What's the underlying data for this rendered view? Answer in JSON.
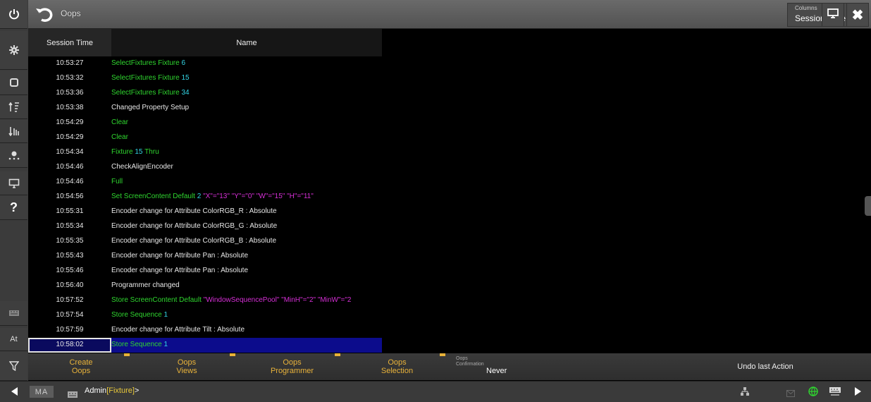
{
  "window": {
    "title": "Oops",
    "columns_caption": "Columns",
    "columns_value": "Session Time"
  },
  "table": {
    "headers": {
      "time": "Session Time",
      "name": "Name"
    },
    "rows": [
      {
        "time": "10:53:27",
        "parts": [
          {
            "text": "SelectFixtures Fixture ",
            "color": "green"
          },
          {
            "text": "6",
            "color": "cyan"
          }
        ]
      },
      {
        "time": "10:53:32",
        "parts": [
          {
            "text": "SelectFixtures Fixture ",
            "color": "green"
          },
          {
            "text": "15",
            "color": "cyan"
          }
        ]
      },
      {
        "time": "10:53:36",
        "parts": [
          {
            "text": "SelectFixtures Fixture ",
            "color": "green"
          },
          {
            "text": "34",
            "color": "cyan"
          }
        ]
      },
      {
        "time": "10:53:38",
        "parts": [
          {
            "text": "Changed Property Setup",
            "color": "white"
          }
        ]
      },
      {
        "time": "10:54:29",
        "parts": [
          {
            "text": "Clear",
            "color": "green"
          }
        ]
      },
      {
        "time": "10:54:29",
        "parts": [
          {
            "text": "Clear",
            "color": "green"
          }
        ]
      },
      {
        "time": "10:54:34",
        "parts": [
          {
            "text": "Fixture ",
            "color": "green"
          },
          {
            "text": "15",
            "color": "cyan"
          },
          {
            "text": " Thru",
            "color": "green"
          }
        ]
      },
      {
        "time": "10:54:46",
        "parts": [
          {
            "text": "CheckAlignEncoder",
            "color": "white"
          }
        ]
      },
      {
        "time": "10:54:46",
        "parts": [
          {
            "text": "Full",
            "color": "green"
          }
        ]
      },
      {
        "time": "10:54:56",
        "parts": [
          {
            "text": "Set ScreenContent Default ",
            "color": "green"
          },
          {
            "text": "2",
            "color": "cyan"
          },
          {
            "text": " \"X\"=\"13\" \"Y\"=\"0\" \"W\"=\"15\" \"H\"=\"11\"",
            "color": "magenta"
          }
        ]
      },
      {
        "time": "10:55:31",
        "parts": [
          {
            "text": "Encoder change for Attribute ColorRGB_R : Absolute",
            "color": "white"
          }
        ]
      },
      {
        "time": "10:55:34",
        "parts": [
          {
            "text": "Encoder change for Attribute ColorRGB_G : Absolute",
            "color": "white"
          }
        ]
      },
      {
        "time": "10:55:35",
        "parts": [
          {
            "text": "Encoder change for Attribute ColorRGB_B : Absolute",
            "color": "white"
          }
        ]
      },
      {
        "time": "10:55:43",
        "parts": [
          {
            "text": "Encoder change for Attribute Pan : Absolute",
            "color": "white"
          }
        ]
      },
      {
        "time": "10:55:46",
        "parts": [
          {
            "text": "Encoder change for Attribute Pan : Absolute",
            "color": "white"
          }
        ]
      },
      {
        "time": "10:56:40",
        "parts": [
          {
            "text": "Programmer changed",
            "color": "white"
          }
        ]
      },
      {
        "time": "10:57:52",
        "parts": [
          {
            "text": "Store ScreenContent Default ",
            "color": "green"
          },
          {
            "text": "\"WindowSequencePool\" \"MinH\"=\"2\" \"MinW\"=\"2",
            "color": "magenta"
          }
        ]
      },
      {
        "time": "10:57:54",
        "parts": [
          {
            "text": "Store Sequence ",
            "color": "green"
          },
          {
            "text": "1",
            "color": "cyan"
          }
        ]
      },
      {
        "time": "10:57:59",
        "parts": [
          {
            "text": "Encoder change for Attribute Tilt : Absolute",
            "color": "white"
          }
        ]
      },
      {
        "time": "10:58:02",
        "selected": true,
        "parts": [
          {
            "text": "Store Sequence ",
            "color": "green"
          },
          {
            "text": "1",
            "color": "cyan"
          }
        ]
      }
    ]
  },
  "bottom": {
    "create_oops": "Create\nOops",
    "oops_views": "Oops\nViews",
    "oops_programmer": "Oops\nProgrammer",
    "oops_selection": "Oops\nSelection",
    "oops_confirmation_caption": "Oops\nConfirmation",
    "oops_confirmation_value": "Never",
    "undo_last_action": "Undo last Action"
  },
  "sidebar": {
    "at_label": "At"
  },
  "status": {
    "logo": "MA",
    "user": "Admin",
    "object": "[Fixture]",
    "prompt": ">"
  },
  "colors": {
    "green": "#2fd62f",
    "cyan": "#33d6e6",
    "magenta": "#d62fd6",
    "white": "#e8e8e8",
    "accent": "#e8b23a",
    "selection": "#0c0c8c"
  }
}
